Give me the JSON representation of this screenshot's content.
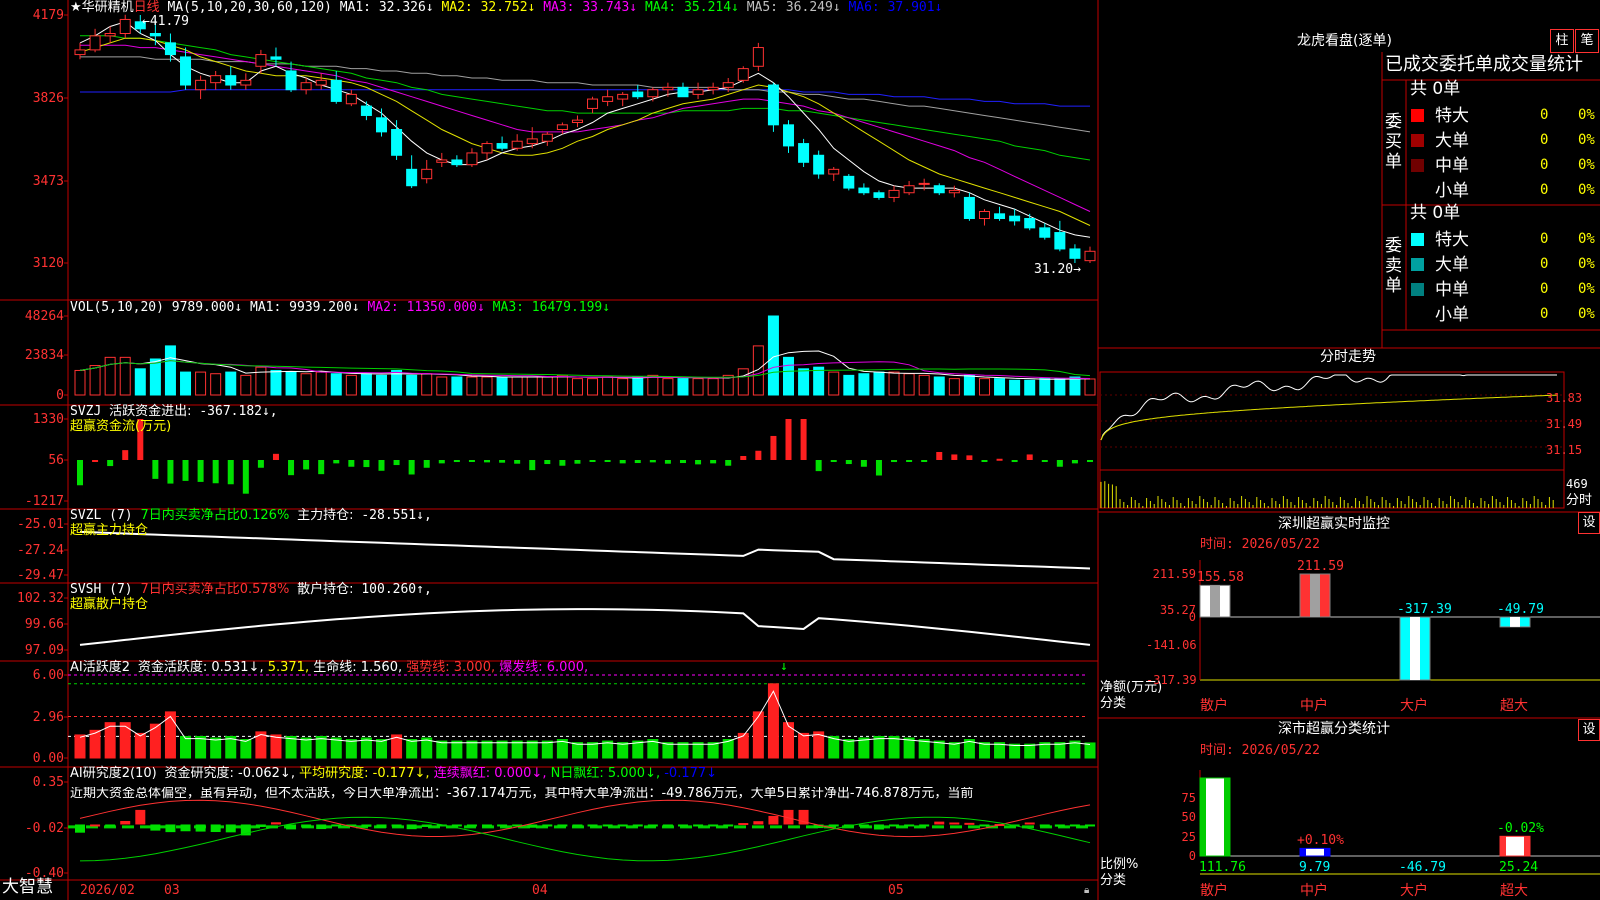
{
  "stock": {
    "name": "★华研精机",
    "period": "日线"
  },
  "price_panel": {
    "ma_header": "MA(5,10,20,30,60,120)",
    "ma": [
      {
        "label": "MA1:",
        "value": "32.326↓",
        "color": "#ffffff"
      },
      {
        "label": "MA2:",
        "value": "32.752↓",
        "color": "#ffff00"
      },
      {
        "label": "MA3:",
        "value": "33.743↓",
        "color": "#ff00ff"
      },
      {
        "label": "MA4:",
        "value": "35.214↓",
        "color": "#00ff00"
      },
      {
        "label": "MA5:",
        "value": "36.249↓",
        "color": "#c0c0c0"
      },
      {
        "label": "MA6:",
        "value": "37.901↓",
        "color": "#0000ff"
      }
    ],
    "yticks": [
      "4179",
      "3826",
      "3473",
      "3120"
    ],
    "high_note": "41.79",
    "low_note": "31.20→"
  },
  "vol_panel": {
    "header": "VOL(5,10,20)",
    "vol": "9789.000↓",
    "ma": [
      {
        "label": "MA1:",
        "value": "9939.200↓",
        "color": "#ffffff"
      },
      {
        "label": "MA2:",
        "value": "11350.000↓",
        "color": "#ff00ff"
      },
      {
        "label": "MA3:",
        "value": "16479.199↓",
        "color": "#00ff00"
      }
    ],
    "yticks": [
      "48264",
      "23834",
      "0"
    ]
  },
  "svzj_panel": {
    "header": "SVZJ",
    "label": "活跃资金进出:",
    "value": "-367.182↓,",
    "sub": "超赢资金流(万元)",
    "yticks": [
      "1330",
      "56",
      "-1217"
    ]
  },
  "svzl_panel": {
    "header": "SVZL (7)",
    "ratio": "7日内买卖净占比0.126%",
    "label": "主力持仓:",
    "value": "-28.551↓,",
    "sub": "超赢主力持仓",
    "yticks": [
      "-25.01",
      "-27.24",
      "-29.47"
    ]
  },
  "svsh_panel": {
    "header": "SVSH (7)",
    "ratio": "7日内买卖净占比0.578%",
    "label": "散户持仓:",
    "value": "100.260↑,",
    "sub": "超赢散户持仓",
    "yticks": [
      "102.32",
      "99.66",
      "97.09"
    ]
  },
  "ai2_panel": {
    "header": "AI活跃度2",
    "items": [
      {
        "text": "资金活跃度: 0.531↓,",
        "color": "#ffffff"
      },
      {
        "text": "5.371,",
        "color": "#ffff00"
      },
      {
        "text": "生命线: 1.560,",
        "color": "#ffffff"
      },
      {
        "text": "强势线: 3.000,",
        "color": "#ff3232"
      },
      {
        "text": "爆发线: 6.000,",
        "color": "#ff00ff"
      }
    ],
    "arrow": "↓",
    "yticks": [
      "6.00",
      "2.96",
      "0.00"
    ]
  },
  "ai_research_panel": {
    "header": "AI研究度2(10)",
    "items": [
      {
        "text": "资金研究度: -0.062↓,",
        "color": "#ffffff"
      },
      {
        "text": "平均研究度: -0.177↓,",
        "color": "#ffff00"
      },
      {
        "text": "连续飘红: 0.000↓,",
        "color": "#ff00ff"
      },
      {
        "text": "N日飘红: 5.000↓,",
        "color": "#00ff00"
      },
      {
        "text": "-0.177↓",
        "color": "#0000ff"
      }
    ],
    "comment": "近期大资金总体偏空，虽有异动，但不太活跃，今日大单净流出：-367.174万元，其中特大单净流出：-49.786万元，大单5日累计净出-746.878万元，当前",
    "yticks": [
      "0.35",
      "-0.02",
      "-0.40"
    ]
  },
  "bottom_bar": {
    "brand": "大智慧",
    "dates": [
      "2026/02",
      "03",
      "04",
      "05"
    ]
  },
  "dragon_tiger": {
    "title": "龙虎看盘(逐单)",
    "btn_zhu": "柱",
    "btn_bi": "笔",
    "subtitle": "已成交委托单成交量统计",
    "buy_label": "委买单",
    "sell_label": "委卖单",
    "buy_total": "共 0单",
    "sell_total": "共 0单",
    "buy_rows": [
      {
        "name": "特大",
        "count": "0",
        "pct": "0%",
        "color": "#ff0000"
      },
      {
        "name": "大单",
        "count": "0",
        "pct": "0%",
        "color": "#a00000"
      },
      {
        "name": "中单",
        "count": "0",
        "pct": "0%",
        "color": "#700000"
      },
      {
        "name": "小单",
        "count": "0",
        "pct": "0%",
        "color": ""
      }
    ],
    "sell_rows": [
      {
        "name": "特大",
        "count": "0",
        "pct": "0%",
        "color": "#00ffff"
      },
      {
        "name": "大单",
        "count": "0",
        "pct": "0%",
        "color": "#00a0a0"
      },
      {
        "name": "中单",
        "count": "0",
        "pct": "0%",
        "color": "#008080"
      },
      {
        "name": "小单",
        "count": "0",
        "pct": "0%",
        "color": ""
      }
    ]
  },
  "intraday": {
    "title": "分时走势",
    "yticks": [
      "31.83",
      "31.49",
      "31.15"
    ],
    "vol_tick": "469",
    "vol_label": "分时"
  },
  "sz_monitor": {
    "title": "深圳超赢实时监控",
    "btn": "设",
    "time": "时间: 2026/05/22",
    "yticks": [
      "211.59",
      "35.27",
      "0",
      "-141.06",
      "-317.39"
    ],
    "ylabel1": "净额(万元)",
    "ylabel2": "分类",
    "bars": [
      {
        "cat": "散户",
        "value": 155.58,
        "label": "155.58",
        "color": "#ffffff"
      },
      {
        "cat": "中户",
        "value": 211.59,
        "label": "211.59",
        "color": "#ff3232"
      },
      {
        "cat": "大户",
        "value": -317.39,
        "label": "-317.39",
        "color": "#00ffff"
      },
      {
        "cat": "超大",
        "value": -49.79,
        "label": "-49.79",
        "color": "#00ffff"
      }
    ]
  },
  "sz_class": {
    "title": "深市超赢分类统计",
    "btn": "设",
    "time": "时间: 2026/05/22",
    "yticks": [
      "75",
      "50",
      "25",
      "0"
    ],
    "ylabel1": "比例%",
    "ylabel2": "分类",
    "bars": [
      {
        "cat": "散户",
        "value": 111.76,
        "label": "111.76",
        "top_label": "",
        "bar_color": "#00cc00"
      },
      {
        "cat": "中户",
        "value": 9.79,
        "label": "9.79",
        "top_label": "+0.10%",
        "bar_color": "#0000ff"
      },
      {
        "cat": "大户",
        "value": -46.79,
        "label": "-46.79",
        "top_label": "",
        "bar_color": ""
      },
      {
        "cat": "超大",
        "value": 25.24,
        "label": "25.24",
        "top_label": "-0.02%",
        "bar_color": "#ff3232"
      }
    ]
  },
  "chart_data": {
    "type": "candlestick",
    "title": "华研精机 日线",
    "ylim": [
      31.2,
      41.79
    ],
    "ohlc": [
      [
        40.1,
        40.6,
        39.9,
        40.3
      ],
      [
        40.3,
        41.2,
        40.2,
        40.9
      ],
      [
        40.9,
        41.3,
        40.6,
        41.0
      ],
      [
        41.0,
        41.8,
        40.8,
        41.6
      ],
      [
        41.5,
        41.79,
        41.0,
        41.2
      ],
      [
        41.0,
        41.6,
        40.5,
        40.9
      ],
      [
        40.6,
        41.0,
        39.8,
        40.1
      ],
      [
        40.0,
        40.4,
        38.6,
        38.8
      ],
      [
        38.6,
        39.2,
        38.2,
        39.0
      ],
      [
        38.9,
        39.4,
        38.6,
        39.2
      ],
      [
        39.2,
        39.6,
        38.6,
        38.8
      ],
      [
        38.8,
        39.3,
        38.6,
        39.0
      ],
      [
        39.6,
        40.3,
        39.3,
        40.1
      ],
      [
        40.0,
        40.4,
        39.6,
        39.9
      ],
      [
        39.4,
        39.8,
        38.5,
        38.6
      ],
      [
        38.6,
        39.1,
        38.4,
        38.9
      ],
      [
        38.8,
        39.3,
        38.6,
        39.0
      ],
      [
        39.0,
        39.4,
        38.0,
        38.1
      ],
      [
        38.0,
        38.6,
        37.9,
        38.4
      ],
      [
        37.9,
        38.1,
        37.3,
        37.5
      ],
      [
        37.4,
        37.8,
        36.6,
        36.8
      ],
      [
        36.9,
        37.3,
        35.6,
        35.8
      ],
      [
        35.2,
        35.8,
        34.4,
        34.5
      ],
      [
        34.8,
        35.6,
        34.6,
        35.2
      ],
      [
        35.5,
        35.9,
        35.3,
        35.6
      ],
      [
        35.6,
        35.8,
        35.3,
        35.4
      ],
      [
        35.4,
        36.1,
        35.3,
        35.9
      ],
      [
        35.9,
        36.4,
        35.6,
        36.3
      ],
      [
        36.3,
        36.6,
        36.0,
        36.1
      ],
      [
        36.1,
        36.7,
        36.0,
        36.4
      ],
      [
        36.3,
        37.0,
        36.1,
        36.5
      ],
      [
        36.4,
        36.8,
        36.2,
        36.7
      ],
      [
        36.9,
        37.2,
        36.7,
        37.1
      ],
      [
        37.2,
        37.5,
        37.0,
        37.3
      ],
      [
        37.8,
        38.3,
        37.6,
        38.2
      ],
      [
        38.1,
        38.6,
        37.9,
        38.3
      ],
      [
        38.2,
        38.5,
        37.9,
        38.4
      ],
      [
        38.5,
        38.8,
        38.2,
        38.3
      ],
      [
        38.3,
        38.7,
        38.1,
        38.6
      ],
      [
        38.6,
        38.9,
        38.3,
        38.7
      ],
      [
        38.7,
        38.9,
        38.3,
        38.3
      ],
      [
        38.4,
        38.9,
        38.2,
        38.6
      ],
      [
        38.6,
        38.9,
        38.4,
        38.7
      ],
      [
        38.7,
        39.1,
        38.5,
        38.9
      ],
      [
        39.0,
        39.6,
        38.9,
        39.5
      ],
      [
        39.6,
        40.6,
        39.4,
        40.4
      ],
      [
        38.8,
        38.9,
        36.8,
        37.1
      ],
      [
        37.1,
        37.3,
        35.9,
        36.2
      ],
      [
        36.3,
        36.5,
        35.3,
        35.5
      ],
      [
        35.8,
        36.0,
        34.8,
        35.0
      ],
      [
        35.0,
        35.3,
        34.7,
        35.2
      ],
      [
        34.9,
        35.0,
        34.3,
        34.4
      ],
      [
        34.4,
        34.6,
        34.1,
        34.2
      ],
      [
        34.2,
        34.3,
        33.9,
        34.0
      ],
      [
        34.0,
        34.5,
        33.8,
        34.3
      ],
      [
        34.2,
        34.7,
        34.1,
        34.5
      ],
      [
        34.6,
        34.8,
        34.3,
        34.6
      ],
      [
        34.5,
        34.6,
        34.1,
        34.2
      ],
      [
        34.2,
        34.5,
        34.0,
        34.3
      ],
      [
        34.0,
        34.2,
        33.0,
        33.1
      ],
      [
        33.1,
        33.5,
        32.8,
        33.4
      ],
      [
        33.3,
        33.6,
        33.0,
        33.1
      ],
      [
        33.2,
        33.5,
        32.8,
        33.0
      ],
      [
        33.1,
        33.3,
        32.6,
        32.7
      ],
      [
        32.7,
        32.9,
        32.2,
        32.3
      ],
      [
        32.5,
        33.0,
        31.7,
        31.8
      ],
      [
        31.8,
        32.0,
        31.2,
        31.4
      ],
      [
        31.3,
        31.9,
        31.2,
        31.7
      ]
    ],
    "volume": [
      15000,
      18000,
      23000,
      23000,
      16000,
      22000,
      30000,
      14000,
      14000,
      13000,
      14000,
      12000,
      17000,
      15000,
      14000,
      13000,
      14000,
      13000,
      12000,
      13000,
      12000,
      15000,
      12000,
      13000,
      11000,
      11000,
      11000,
      11000,
      11000,
      11000,
      11000,
      11000,
      12000,
      10000,
      10000,
      11000,
      10000,
      11000,
      12000,
      10000,
      10000,
      10000,
      10000,
      12000,
      16000,
      30000,
      48264,
      23000,
      16000,
      17000,
      14000,
      12000,
      13000,
      14000,
      14000,
      13000,
      12000,
      11000,
      10000,
      12000,
      10000,
      10000,
      9000,
      9000,
      10000,
      10000,
      11000,
      9789
    ],
    "ma5": [
      40.6,
      40.9,
      41.3,
      41.5,
      41.0,
      40.7,
      40.1,
      39.6,
      39.3,
      39.1,
      38.9,
      38.9,
      39.4,
      39.6,
      39.3,
      39.1,
      38.8,
      38.6,
      38.4,
      38.0,
      37.6,
      37.0,
      36.4,
      35.9,
      35.6,
      35.4,
      35.4,
      35.6,
      35.9,
      36.1,
      36.2,
      36.4,
      36.7,
      36.9,
      37.2,
      37.6,
      37.8,
      38.0,
      38.2,
      38.4,
      38.5,
      38.5,
      38.6,
      38.7,
      39.0,
      39.3,
      38.9,
      38.3,
      37.6,
      36.9,
      36.1,
      35.6,
      35.1,
      34.7,
      34.5,
      34.4,
      34.4,
      34.4,
      34.4,
      34.2,
      33.9,
      33.7,
      33.5,
      33.2,
      32.9,
      32.6,
      32.4,
      32.3
    ],
    "ma10": [
      40.2,
      40.4,
      40.6,
      40.8,
      40.8,
      40.7,
      40.5,
      40.3,
      40.0,
      39.8,
      39.6,
      39.4,
      39.3,
      39.2,
      39.2,
      39.2,
      39.1,
      39.0,
      38.9,
      38.7,
      38.4,
      38.1,
      37.7,
      37.3,
      36.9,
      36.6,
      36.3,
      36.1,
      35.9,
      35.8,
      35.8,
      35.9,
      36.1,
      36.4,
      36.6,
      36.9,
      37.1,
      37.3,
      37.6,
      37.8,
      38.0,
      38.1,
      38.2,
      38.4,
      38.6,
      38.8,
      38.7,
      38.5,
      38.3,
      38.0,
      37.6,
      37.2,
      36.8,
      36.4,
      36.0,
      35.6,
      35.3,
      35.0,
      34.8,
      34.6,
      34.4,
      34.2,
      34.0,
      33.8,
      33.6,
      33.4,
      33.1,
      32.8
    ],
    "ma20": [
      40.5,
      40.5,
      40.5,
      40.5,
      40.4,
      40.4,
      40.3,
      40.2,
      40.1,
      40.0,
      39.9,
      39.8,
      39.7,
      39.6,
      39.5,
      39.4,
      39.3,
      39.2,
      39.0,
      38.9,
      38.7,
      38.5,
      38.3,
      38.1,
      37.9,
      37.7,
      37.5,
      37.3,
      37.1,
      36.9,
      36.8,
      36.8,
      36.8,
      36.8,
      36.9,
      37.0,
      37.1,
      37.3,
      37.4,
      37.6,
      37.8,
      37.9,
      38.0,
      38.1,
      38.2,
      38.2,
      38.1,
      38.0,
      37.9,
      37.7,
      37.6,
      37.4,
      37.2,
      37.0,
      36.8,
      36.6,
      36.4,
      36.2,
      36.0,
      35.7,
      35.5,
      35.2,
      34.9,
      34.6,
      34.3,
      34.0,
      33.7,
      33.4
    ],
    "ma30": [
      40.9,
      40.9,
      40.9,
      40.8,
      40.8,
      40.7,
      40.6,
      40.5,
      40.4,
      40.3,
      40.1,
      40.0,
      39.9,
      39.8,
      39.7,
      39.6,
      39.5,
      39.4,
      39.3,
      39.1,
      39.0,
      38.9,
      38.7,
      38.6,
      38.4,
      38.3,
      38.2,
      38.1,
      38.0,
      37.9,
      37.8,
      37.7,
      37.7,
      37.6,
      37.6,
      37.6,
      37.6,
      37.6,
      37.6,
      37.6,
      37.7,
      37.7,
      37.7,
      37.7,
      37.8,
      37.8,
      37.8,
      37.7,
      37.7,
      37.6,
      37.5,
      37.4,
      37.3,
      37.2,
      37.1,
      37.0,
      36.9,
      36.8,
      36.7,
      36.6,
      36.5,
      36.4,
      36.2,
      36.1,
      36.0,
      35.8,
      35.7,
      35.6
    ],
    "ma60": [
      40.0,
      40.0,
      40.0,
      40.0,
      40.0,
      39.9,
      39.9,
      39.9,
      39.9,
      39.8,
      39.8,
      39.8,
      39.7,
      39.7,
      39.7,
      39.6,
      39.6,
      39.6,
      39.5,
      39.5,
      39.4,
      39.4,
      39.3,
      39.3,
      39.2,
      39.2,
      39.1,
      39.1,
      39.0,
      39.0,
      39.0,
      38.9,
      38.9,
      38.9,
      38.8,
      38.8,
      38.8,
      38.8,
      38.7,
      38.7,
      38.7,
      38.7,
      38.7,
      38.6,
      38.6,
      38.6,
      38.5,
      38.5,
      38.4,
      38.4,
      38.3,
      38.2,
      38.2,
      38.1,
      38.0,
      37.9,
      37.9,
      37.8,
      37.7,
      37.6,
      37.5,
      37.4,
      37.3,
      37.2,
      37.1,
      37.0,
      36.9,
      36.8
    ],
    "ma120": [
      38.5,
      38.5,
      38.5,
      38.5,
      38.5,
      38.5,
      38.5,
      38.6,
      38.6,
      38.6,
      38.6,
      38.6,
      38.6,
      38.6,
      38.6,
      38.6,
      38.6,
      38.6,
      38.6,
      38.6,
      38.6,
      38.6,
      38.6,
      38.6,
      38.6,
      38.6,
      38.6,
      38.6,
      38.6,
      38.6,
      38.6,
      38.6,
      38.6,
      38.6,
      38.6,
      38.6,
      38.6,
      38.6,
      38.6,
      38.6,
      38.6,
      38.6,
      38.6,
      38.6,
      38.6,
      38.6,
      38.6,
      38.6,
      38.5,
      38.5,
      38.5,
      38.4,
      38.4,
      38.4,
      38.3,
      38.3,
      38.3,
      38.2,
      38.2,
      38.2,
      38.1,
      38.1,
      38.0,
      38.0,
      38.0,
      37.9,
      37.9,
      37.9
    ],
    "svzj": [
      -750,
      0,
      -180,
      320,
      1330,
      -560,
      -700,
      -620,
      -650,
      -690,
      -720,
      -1000,
      -230,
      200,
      -450,
      -280,
      -420,
      -100,
      -200,
      -210,
      -320,
      -150,
      -430,
      -230,
      -100,
      -60,
      -50,
      -70,
      -80,
      -110,
      -300,
      -120,
      -170,
      -110,
      -50,
      -50,
      -100,
      -90,
      -70,
      -110,
      -90,
      -130,
      -100,
      -170,
      130,
      300,
      780,
      1330,
      1330,
      -330,
      -40,
      -120,
      -200,
      -460,
      -60,
      -40,
      -20,
      260,
      180,
      150,
      -50,
      40,
      -60,
      180,
      -40,
      -200,
      -100,
      -60,
      -80,
      -320,
      -367
    ]
  }
}
